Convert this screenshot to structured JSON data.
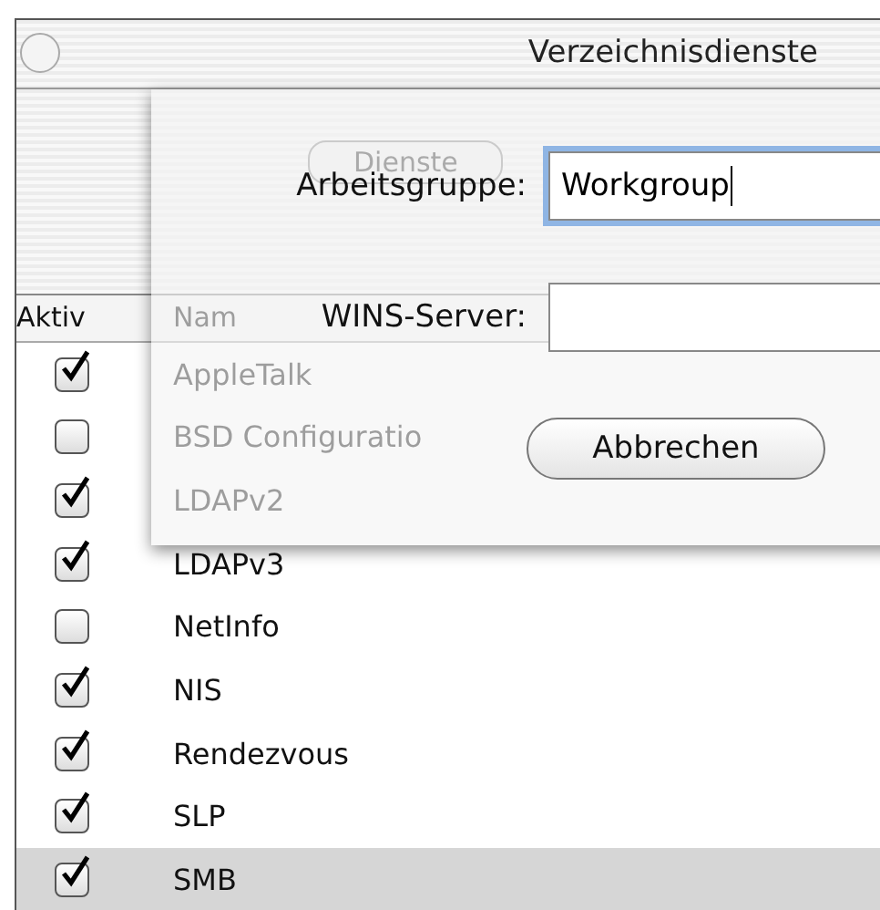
{
  "window": {
    "title": "Verzeichnisdienste"
  },
  "toolbar": {
    "tab": {
      "label": "Dienste"
    }
  },
  "table": {
    "columns": [
      "Aktiv",
      "Nam"
    ],
    "rows": [
      {
        "name": "AppleTalk",
        "checked": true,
        "selected": false
      },
      {
        "name": "BSD Configuratio",
        "checked": false,
        "selected": false
      },
      {
        "name": "LDAPv2",
        "checked": true,
        "selected": false
      },
      {
        "name": "LDAPv3",
        "checked": true,
        "selected": false
      },
      {
        "name": "NetInfo",
        "checked": false,
        "selected": false
      },
      {
        "name": "NIS",
        "checked": true,
        "selected": false
      },
      {
        "name": "Rendezvous",
        "checked": true,
        "selected": false
      },
      {
        "name": "SLP",
        "checked": true,
        "selected": false
      },
      {
        "name": "SMB",
        "checked": true,
        "selected": true
      }
    ]
  },
  "sheet": {
    "fields": [
      {
        "label": "Arbeitsgruppe:",
        "value": "Workgroup",
        "focused": true
      },
      {
        "label": "WINS-Server:",
        "focused": false
      }
    ],
    "button": "Abbrechen"
  }
}
